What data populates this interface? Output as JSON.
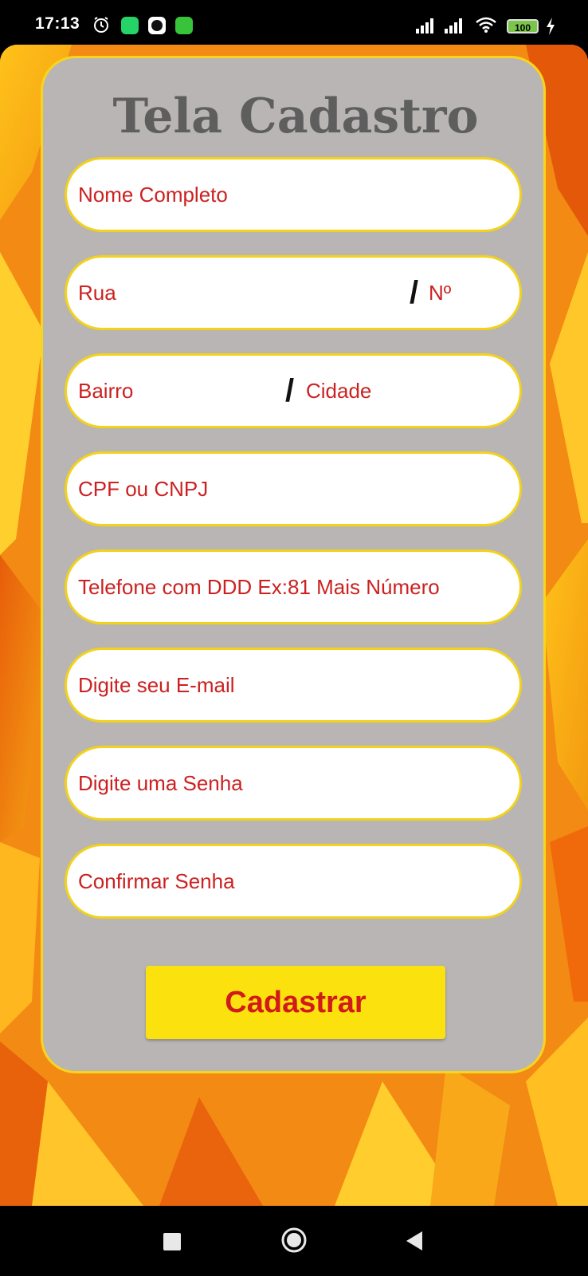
{
  "status_bar": {
    "time": "17:13",
    "battery": "100",
    "icons": [
      "alarm-icon",
      "whatsapp-icon",
      "app-icon",
      "android-icon",
      "signal-icon",
      "signal-icon",
      "wifi-icon",
      "battery-icon",
      "charging-icon"
    ]
  },
  "form": {
    "title": "Tela Cadastro",
    "fields": {
      "nome": "Nome Completo",
      "rua": "Rua",
      "numero": "Nº",
      "bairro": "Bairro",
      "cidade": "Cidade",
      "cpf": "CPF ou CNPJ",
      "telefone": "Telefone com DDD Ex:81 Mais Número",
      "email": "Digite seu E-mail",
      "senha": "Digite uma Senha",
      "confirmar": "Confirmar Senha"
    },
    "separator": "/",
    "submit_label": "Cadastrar"
  },
  "colors": {
    "background": "#f07a12",
    "card": "#b8b5b4",
    "border": "#f7d51c",
    "placeholder": "#cc2121",
    "button": "#fbe10d",
    "button_text": "#d11a1a",
    "title": "#5e5e5e"
  },
  "nav_bar": {
    "icons": [
      "recents-icon",
      "home-icon",
      "back-icon"
    ]
  }
}
